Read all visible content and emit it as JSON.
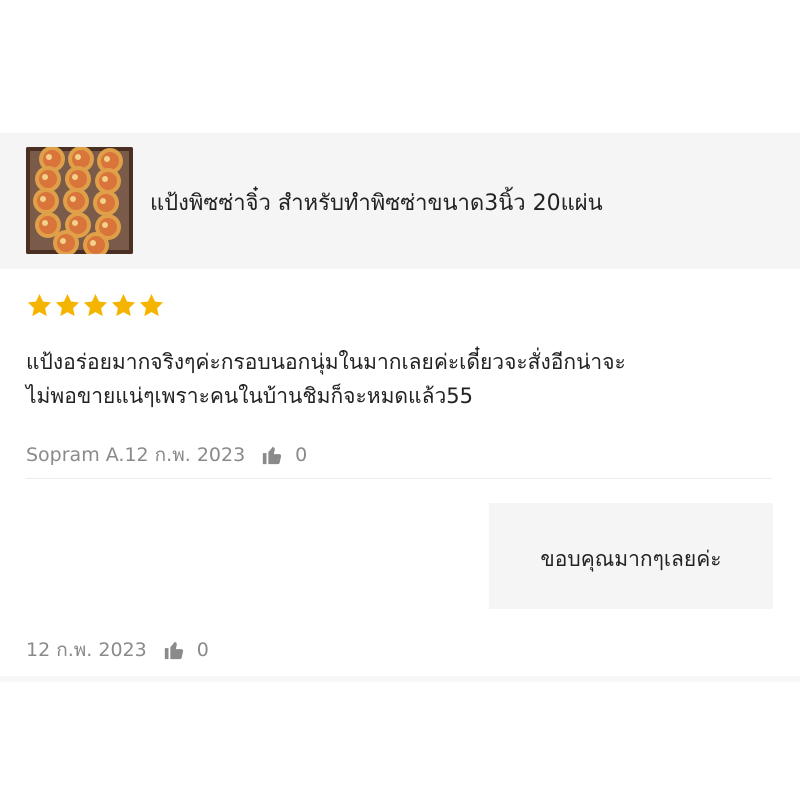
{
  "product": {
    "title": "แป้งพิซซ่าจิ๋ว สำหรับทำพิซซ่าขนาด3นิ้ว 20แผ่น",
    "thumbnail_icon": "pizza-tray-image"
  },
  "review": {
    "rating": 5,
    "rating_max": 5,
    "star_color": "#f5b400",
    "text_line1": "แป้งอร่อยมากจริงๆค่ะกรอบนอกนุ่มในมากเลยค่ะเดี๋ยวจะสั่งอีกน่าจะ",
    "text_line2": "ไม่พอขายแน่ๆเพราะคนในบ้านชิมก็จะหมดแล้ว55",
    "author_date": "Sopram A.12 ก.พ. 2023",
    "like_count": "0"
  },
  "reply": {
    "text": "ขอบคุณมากๆเลยค่ะ",
    "date": "12 ก.พ. 2023",
    "like_count": "0"
  }
}
